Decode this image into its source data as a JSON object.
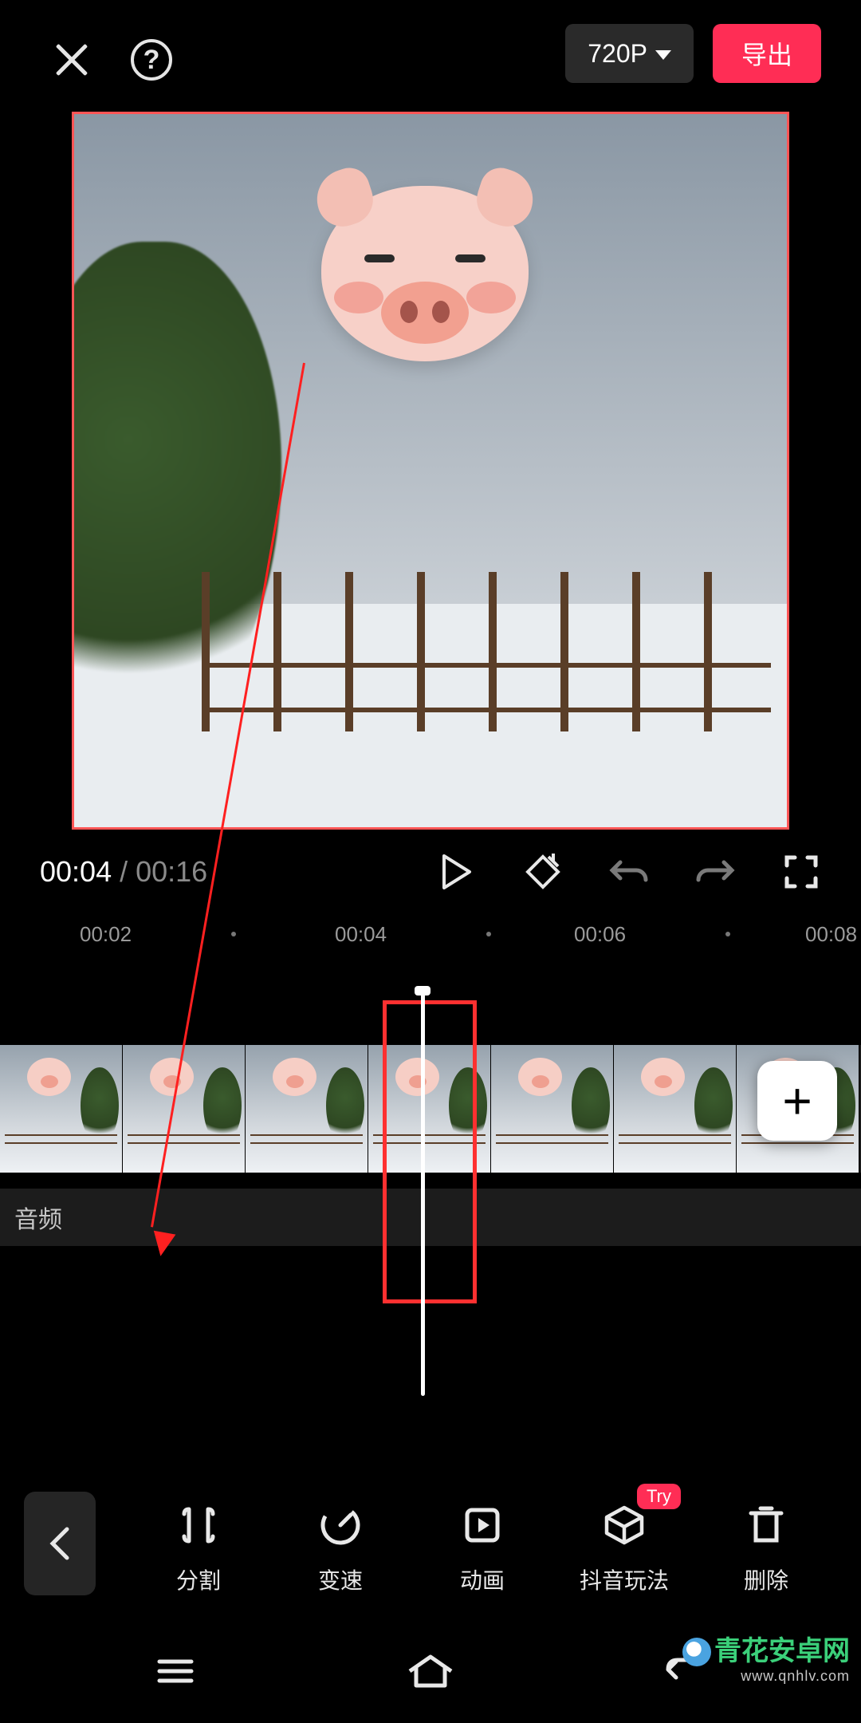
{
  "header": {
    "resolution_label": "720P",
    "export_label": "导出"
  },
  "transport": {
    "current_time": "00:04",
    "separator": " / ",
    "duration": "00:16"
  },
  "ruler": {
    "ticks": [
      "00:02",
      "00:04",
      "00:06",
      "00:08"
    ]
  },
  "audio_track_label": "音频",
  "add_button_label": "+",
  "toolbar": {
    "items": [
      {
        "id": "split",
        "label": "分割"
      },
      {
        "id": "speed",
        "label": "变速"
      },
      {
        "id": "anim",
        "label": "动画"
      },
      {
        "id": "douyin",
        "label": "抖音玩法",
        "badge": "Try"
      },
      {
        "id": "delete",
        "label": "删除"
      }
    ]
  },
  "watermark": {
    "brand": "青花安卓网",
    "url": "www.qnhlv.com"
  },
  "colors": {
    "accent": "#ff2d55",
    "annotation": "#ff3030"
  }
}
